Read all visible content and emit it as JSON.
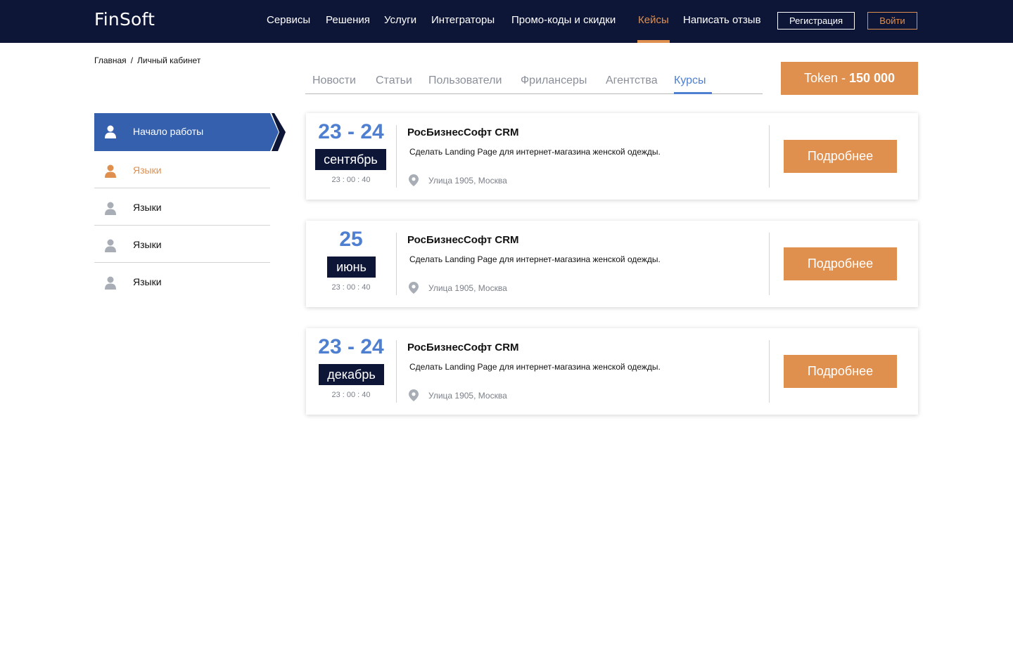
{
  "header": {
    "logo": "FinSoft",
    "nav": [
      "Сервисы",
      "Решения",
      "Услуги",
      "Интеграторы",
      "Промо-коды и скидки",
      "Кейсы",
      "Написать отзыв"
    ],
    "active_nav": "Кейсы",
    "register_label": "Регистрация",
    "login_label": "Войти"
  },
  "breadcrumb": {
    "home": "Главная",
    "separator": "/",
    "current": "Личный кабинет"
  },
  "tabs": [
    "Новости",
    "Статьи",
    "Пользователи",
    "Фрилансеры",
    "Агентства",
    "Курсы"
  ],
  "active_tab": "Курсы",
  "token": {
    "label": "Token -",
    "value": "150 000"
  },
  "sidebar": {
    "items": [
      {
        "label": "Начало работы",
        "state": "active"
      },
      {
        "label": "Языки",
        "state": "highlighted"
      },
      {
        "label": "Языки",
        "state": "normal"
      },
      {
        "label": "Языки",
        "state": "normal"
      },
      {
        "label": "Языки",
        "state": "normal"
      }
    ]
  },
  "events": [
    {
      "date": "23 - 24",
      "month": "сентябрь",
      "time": "23 : 00 : 40",
      "title": "РосБизнесСофт CRM",
      "description": "Сделать Landing Page для интернет-магазина женской одежды.",
      "address": "Улица 1905, Москва",
      "button": "Подробнее"
    },
    {
      "date": "25",
      "month": "июнь",
      "time": "23 : 00 : 40",
      "title": "РосБизнесСофт CRM",
      "description": "Сделать Landing Page для интернет-магазина женской одежды.",
      "address": "Улица 1905, Москва",
      "button": "Подробнее"
    },
    {
      "date": "23 - 24",
      "month": "декабрь",
      "time": "23 : 00 : 40",
      "title": "РосБизнесСофт CRM",
      "description": "Сделать Landing Page для интернет-магазина женской одежды.",
      "address": "Улица 1905, Москва",
      "button": "Подробнее"
    }
  ],
  "colors": {
    "navy": "#0e1638",
    "accent_orange": "#e0904e",
    "accent_blue": "#4f7fd0",
    "sidebar_active": "#3560ae"
  }
}
